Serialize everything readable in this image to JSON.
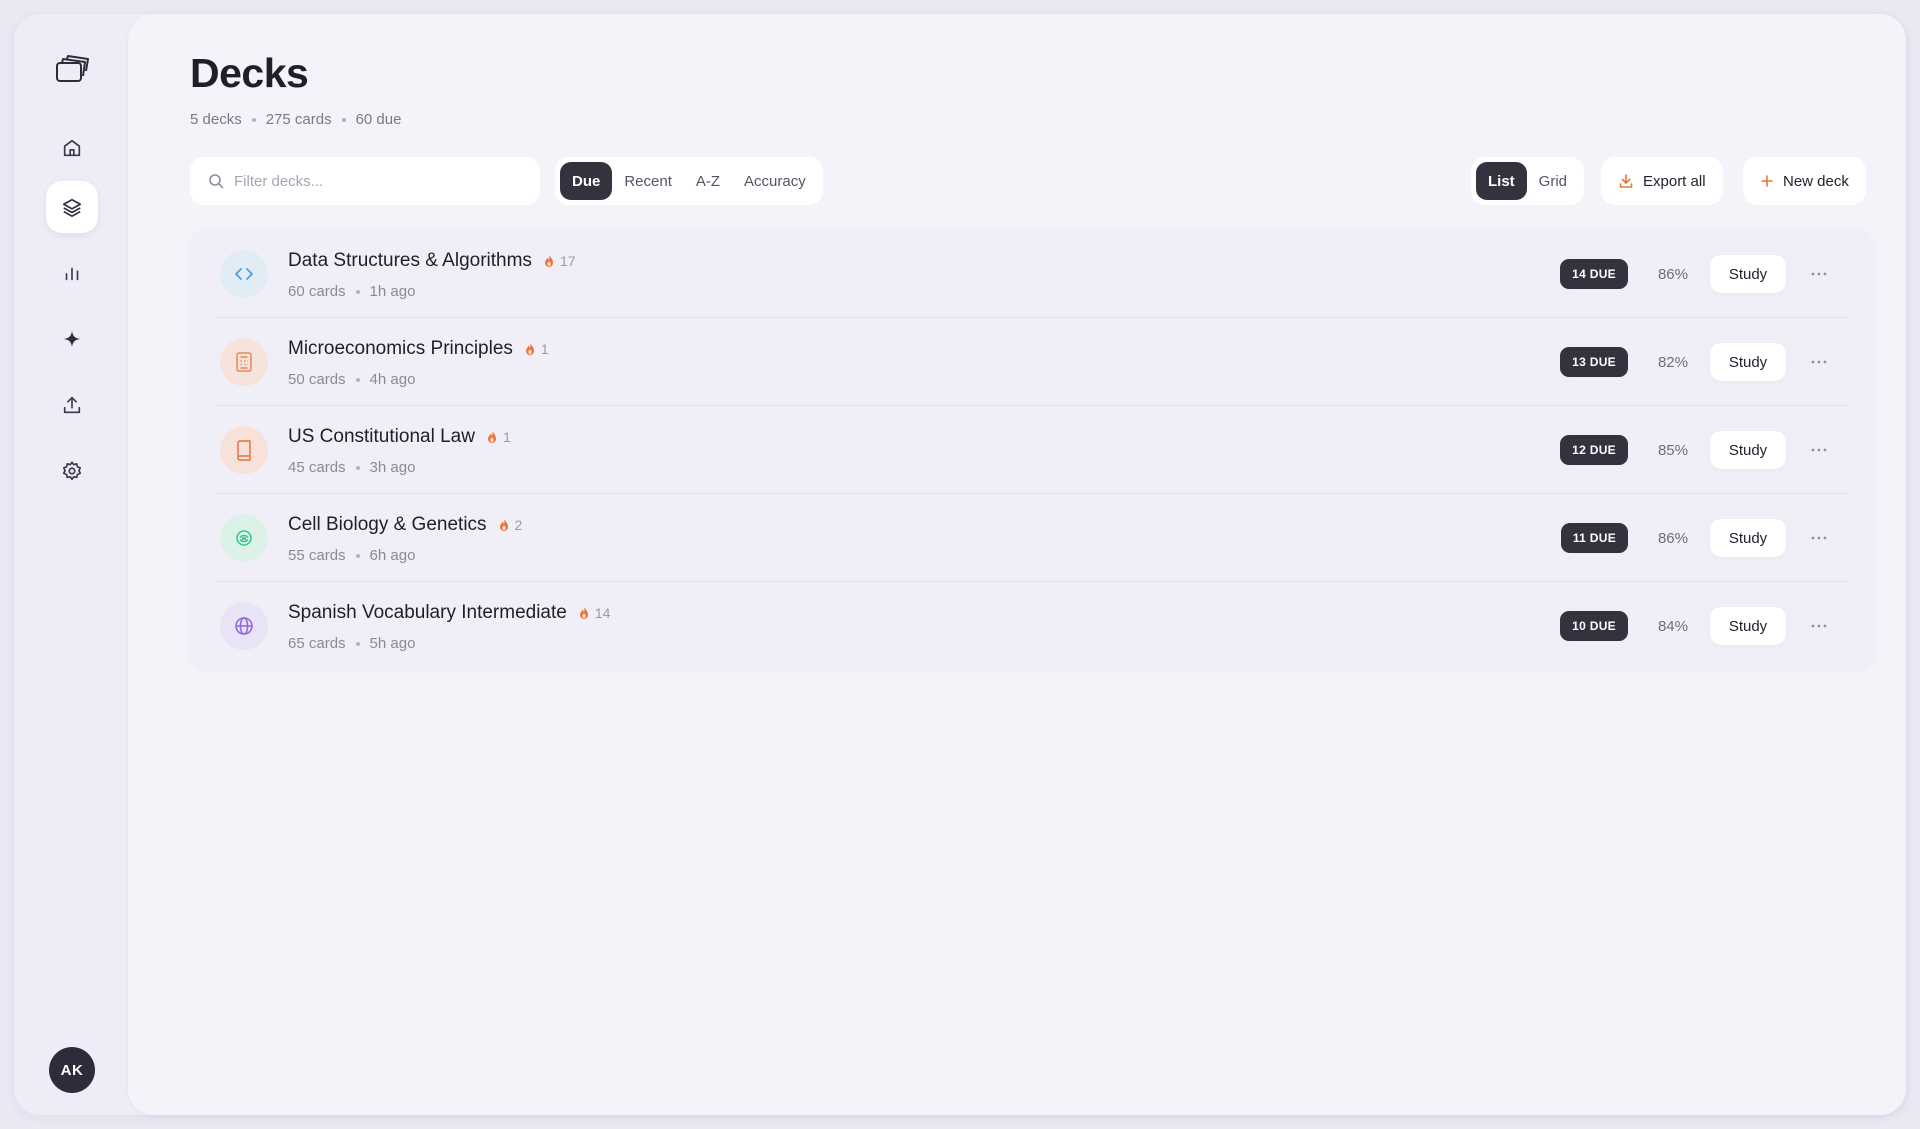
{
  "header": {
    "title": "Decks",
    "summary": {
      "decks": "5 decks",
      "cards": "275 cards",
      "due": "60 due"
    }
  },
  "search": {
    "placeholder": "Filter decks..."
  },
  "sort_tabs": [
    {
      "label": "Due",
      "active": true
    },
    {
      "label": "Recent",
      "active": false
    },
    {
      "label": "A-Z",
      "active": false
    },
    {
      "label": "Accuracy",
      "active": false
    }
  ],
  "view_toggle": [
    {
      "label": "List",
      "active": true
    },
    {
      "label": "Grid",
      "active": false
    }
  ],
  "actions": {
    "export_label": "Export all",
    "new_deck_label": "New deck"
  },
  "sidebar": {
    "items": [
      {
        "name": "home-icon",
        "active": false
      },
      {
        "name": "decks-icon",
        "active": true
      },
      {
        "name": "stats-icon",
        "active": false
      },
      {
        "name": "sparkle-icon",
        "active": false
      },
      {
        "name": "upload-icon",
        "active": false
      },
      {
        "name": "settings-icon",
        "active": false
      }
    ],
    "avatar_initials": "AK"
  },
  "decks": [
    {
      "name": "Data Structures & Algorithms",
      "streak": "17",
      "cards": "60 cards",
      "last": "1h ago",
      "due": "14 DUE",
      "accuracy": "86%",
      "study_label": "Study",
      "icon": "code-icon",
      "icon_color": "#4f9fe0",
      "icon_bg": "#e1ecf5"
    },
    {
      "name": "Microeconomics Principles",
      "streak": "1",
      "cards": "50 cards",
      "last": "4h ago",
      "due": "13 DUE",
      "accuracy": "82%",
      "study_label": "Study",
      "icon": "calculator-icon",
      "icon_color": "#e98b5e",
      "icon_bg": "#f6e3dc"
    },
    {
      "name": "US Constitutional Law",
      "streak": "1",
      "cards": "45 cards",
      "last": "3h ago",
      "due": "12 DUE",
      "accuracy": "85%",
      "study_label": "Study",
      "icon": "book-icon",
      "icon_color": "#e5824f",
      "icon_bg": "#f7e2da"
    },
    {
      "name": "Cell Biology & Genetics",
      "streak": "2",
      "cards": "55 cards",
      "last": "6h ago",
      "due": "11 DUE",
      "accuracy": "86%",
      "study_label": "Study",
      "icon": "cell-icon",
      "icon_color": "#3cc98b",
      "icon_bg": "#dcf2e8"
    },
    {
      "name": "Spanish Vocabulary Intermediate",
      "streak": "14",
      "cards": "65 cards",
      "last": "5h ago",
      "due": "10 DUE",
      "accuracy": "84%",
      "study_label": "Study",
      "icon": "globe-icon",
      "icon_color": "#8f6ae0",
      "icon_bg": "#e9e3f6"
    }
  ],
  "colors": {
    "accent_dark": "#33323f",
    "streak": "#e9743b",
    "background": "#f4f3fa"
  }
}
